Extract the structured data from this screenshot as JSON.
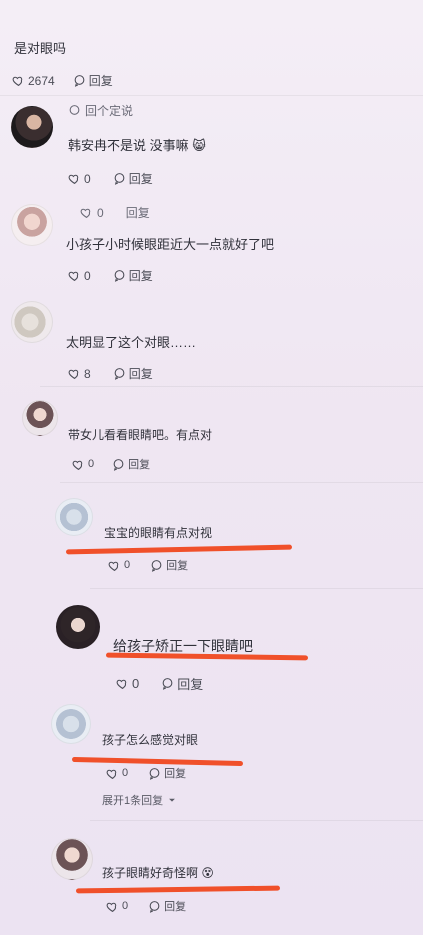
{
  "top_comment": {
    "text": "是对眼吗",
    "likes": "2674",
    "reply_label": "回复"
  },
  "comments": [
    {
      "partial_label": "回个定说",
      "text": "韩安冉不是说 没事嘛 😸",
      "likes": "0",
      "reply_label": "回复"
    },
    {
      "partial_likes": "0",
      "partial_reply": "回复",
      "text": "小孩子小时候眼距近大一点就好了吧",
      "likes": "0",
      "reply_label": "回复"
    },
    {
      "text": "太明显了这个对眼……",
      "likes": "8",
      "reply_label": "回复"
    },
    {
      "text": "带女儿看看眼睛吧。有点对",
      "likes": "0",
      "reply_label": "回复"
    },
    {
      "text": "宝宝的眼睛有点对视",
      "likes": "0",
      "reply_label": "回复"
    },
    {
      "text": "给孩子矫正一下眼睛吧",
      "likes": "0",
      "reply_label": "回复"
    },
    {
      "text": "孩子怎么感觉对眼",
      "likes": "0",
      "reply_label": "回复",
      "expand_label": "展开1条回复"
    },
    {
      "text": "孩子眼睛好奇怪啊 😵",
      "likes": "0",
      "reply_label": "回复"
    }
  ],
  "colors": {
    "underline": "#f0502a",
    "background": "#efe6f2"
  },
  "icons": {
    "like": "heart-icon",
    "reply": "comment-bubble-icon",
    "expand": "chevron-down-icon"
  }
}
